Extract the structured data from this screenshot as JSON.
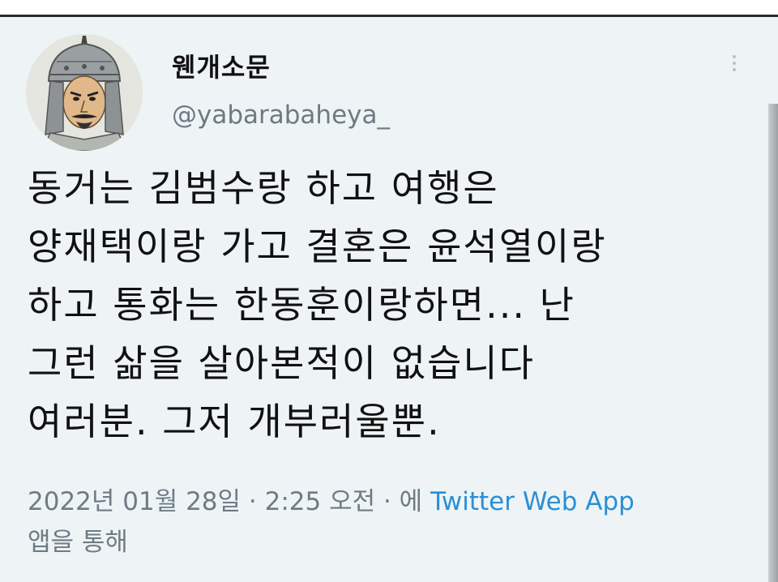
{
  "tweet": {
    "display_name": "웬개소문",
    "handle": "@yabarabaheya_",
    "text_lines": [
      "동거는 김범수랑 하고 여행은",
      "양재택이랑 가고 결혼은 윤석열이랑",
      "하고 통화는 한동훈이랑하면... 난",
      "그런 삶을 살아본적이 없습니다",
      "여러분. 그저 개부러울뿐."
    ],
    "timestamp": "2022년 01월 28일 · 2:25 오전 · 에",
    "source": "Twitter Web App",
    "via_suffix": "앱을 통해"
  },
  "icons": {
    "avatar": "general-portrait-avatar",
    "more": "more-options-icon"
  },
  "colors": {
    "background": "#eef4f5",
    "text": "#111111",
    "muted": "#6e7b85",
    "link": "#2a8fd6"
  }
}
